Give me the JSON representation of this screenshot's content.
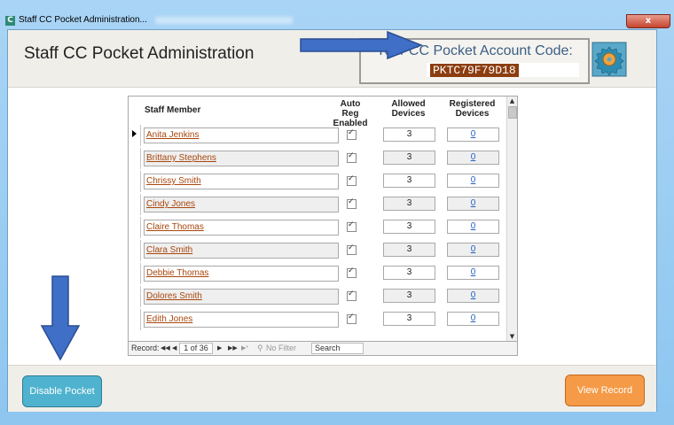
{
  "window": {
    "title": "Staff CC Pocket Administration...",
    "close_label": "x"
  },
  "header": {
    "title": "Staff CC Pocket Administration",
    "account_code_label": "Your CC Pocket Account Code:",
    "account_code": "PKTC79F79D18"
  },
  "grid": {
    "columns": {
      "staff_member": "Staff Member",
      "auto_reg_1": "Auto Reg",
      "auto_reg_2": "Enabled",
      "allowed_1": "Allowed",
      "allowed_2": "Devices",
      "registered_1": "Registered",
      "registered_2": "Devices"
    },
    "rows": [
      {
        "name": "Anita Jenkins",
        "auto_reg": true,
        "allowed": "3",
        "registered": "0"
      },
      {
        "name": "Brittany Stephens",
        "auto_reg": true,
        "allowed": "3",
        "registered": "0"
      },
      {
        "name": "Chrissy Smith",
        "auto_reg": true,
        "allowed": "3",
        "registered": "0"
      },
      {
        "name": "Cindy Jones",
        "auto_reg": true,
        "allowed": "3",
        "registered": "0"
      },
      {
        "name": "Claire Thomas",
        "auto_reg": true,
        "allowed": "3",
        "registered": "0"
      },
      {
        "name": "Clara Smith",
        "auto_reg": true,
        "allowed": "3",
        "registered": "0"
      },
      {
        "name": "Debbie Thomas",
        "auto_reg": true,
        "allowed": "3",
        "registered": "0"
      },
      {
        "name": "Dolores Smith",
        "auto_reg": true,
        "allowed": "3",
        "registered": "0"
      },
      {
        "name": "Edith Jones",
        "auto_reg": true,
        "allowed": "3",
        "registered": "0"
      }
    ]
  },
  "navigation": {
    "record_label": "Record:",
    "first": "◀◀",
    "prev": "◀",
    "current": "1 of 36",
    "next": "▶",
    "last": "▶▶",
    "new": "▶*",
    "no_filter": "No Filter",
    "search_placeholder": "Search"
  },
  "footer": {
    "disable_label": "Disable Pocket",
    "view_record_label": "View Record"
  },
  "colors": {
    "header_bg": "#f0eee9",
    "account_code_bg": "#8c3d0f",
    "disable_button": "#4fb3cf",
    "view_record_button": "#f59a47",
    "arrow": "#3f6fc6"
  }
}
